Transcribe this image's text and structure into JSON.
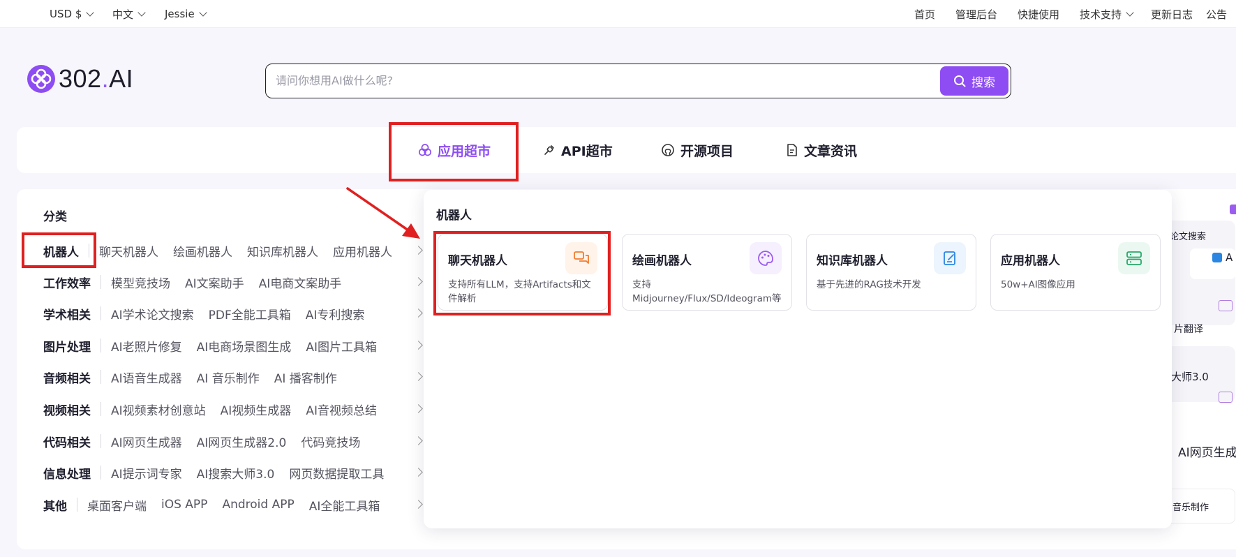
{
  "topbar": {
    "currency": "USD $",
    "language": "中文",
    "user": "Jessie",
    "nav": {
      "home": "首页",
      "admin": "管理后台",
      "quickstart": "快捷使用",
      "support": "技术支持",
      "changelog": "更新日志",
      "announcement": "公告"
    }
  },
  "logo": {
    "name": "302",
    "dot": ".",
    "suffix": "AI"
  },
  "search": {
    "placeholder": "请问你想用AI做什么呢?",
    "button_label": "搜索"
  },
  "tabs": [
    {
      "label": "应用超市",
      "icon": "apps-icon",
      "active": true
    },
    {
      "label": "API超市",
      "icon": "plug-icon"
    },
    {
      "label": "开源项目",
      "icon": "github-icon"
    },
    {
      "label": "文章资讯",
      "icon": "document-icon"
    }
  ],
  "categories": {
    "heading": "分类",
    "rows": [
      {
        "name": "机器人",
        "subs": [
          "聊天机器人",
          "绘画机器人",
          "知识库机器人",
          "应用机器人"
        ]
      },
      {
        "name": "工作效率",
        "subs": [
          "模型竞技场",
          "AI文案助手",
          "AI电商文案助手"
        ]
      },
      {
        "name": "学术相关",
        "subs": [
          "AI学术论文搜索",
          "PDF全能工具箱",
          "AI专利搜索"
        ]
      },
      {
        "name": "图片处理",
        "subs": [
          "AI老照片修复",
          "AI电商场景图生成",
          "AI图片工具箱"
        ]
      },
      {
        "name": "音频相关",
        "subs": [
          "AI语音生成器",
          "AI 音乐制作",
          "AI 播客制作"
        ]
      },
      {
        "name": "视频相关",
        "subs": [
          "AI视频素材创意站",
          "AI视频生成器",
          "AI音视频总结"
        ]
      },
      {
        "name": "代码相关",
        "subs": [
          "AI网页生成器",
          "AI网页生成器2.0",
          "代码竞技场"
        ]
      },
      {
        "name": "信息处理",
        "subs": [
          "AI提示词专家",
          "AI搜索大师3.0",
          "网页数据提取工具"
        ]
      },
      {
        "name": "其他",
        "subs": [
          "桌面客户端",
          "iOS APP",
          "Android APP",
          "AI全能工具箱"
        ]
      }
    ]
  },
  "popup": {
    "title": "机器人",
    "cards": [
      {
        "title": "聊天机器人",
        "desc": "支持所有LLM，支持Artifacts和文件解析",
        "icon": "chat-icon",
        "color": "#f07b30",
        "bg": "#fff3ea"
      },
      {
        "title": "绘画机器人",
        "desc": "支持Midjourney/Flux/SD/Ideogram等模型",
        "icon": "palette-icon",
        "color": "#9b5cf0",
        "bg": "#f5effe"
      },
      {
        "title": "知识库机器人",
        "desc": "基于先进的RAG技术开发",
        "icon": "notebook-icon",
        "color": "#2a86e0",
        "bg": "#ecf4fd"
      },
      {
        "title": "应用机器人",
        "desc": "50w+AI图像应用",
        "icon": "server-icon",
        "color": "#27a86a",
        "bg": "#ebf8f1"
      }
    ]
  },
  "background_peek": {
    "t1": "论文搜索",
    "t2": "A",
    "t3": "片翻译",
    "t4": "大师3.0",
    "t5": "AI网页生成",
    "t6": "音乐制作"
  },
  "colors": {
    "accent": "#8d4df2",
    "highlight": "#e02020"
  }
}
